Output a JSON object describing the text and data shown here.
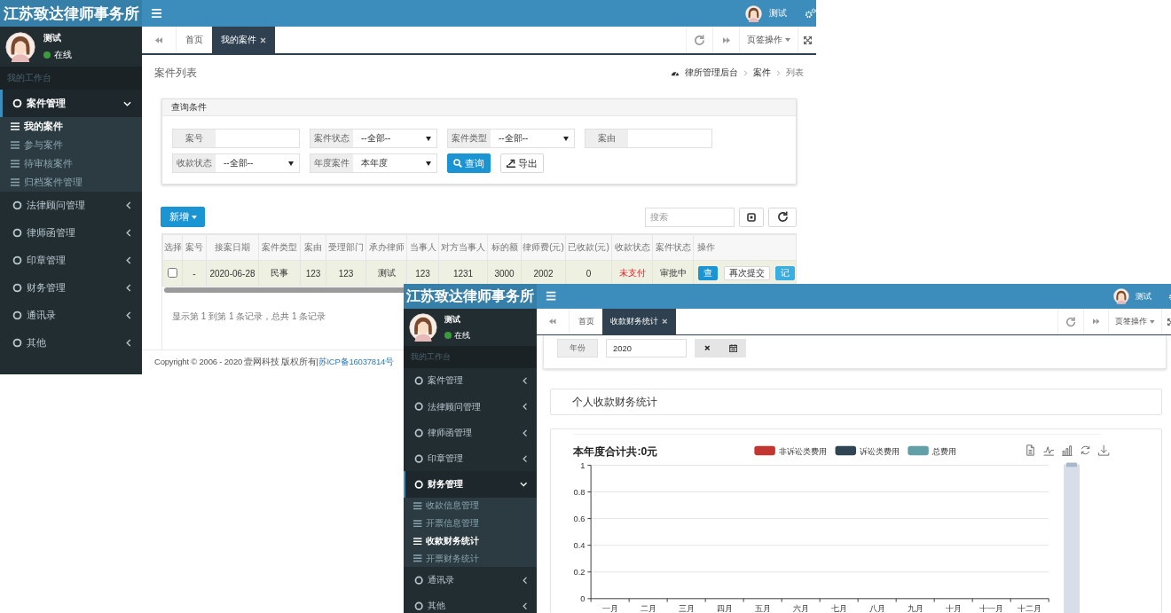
{
  "windows": [
    {
      "kind": "case-list",
      "brand": "江苏致达律师事务所",
      "user": {
        "name": "测试",
        "status": "在线"
      },
      "workbench": "我的工作台",
      "menu": [
        {
          "label": "案件管理",
          "expanded": true,
          "children": [
            {
              "label": "我的案件",
              "selected": true
            },
            {
              "label": "参与案件",
              "selected": false
            },
            {
              "label": "待审核案件",
              "selected": false
            },
            {
              "label": "归档案件管理",
              "selected": false
            }
          ]
        },
        {
          "label": "法律顾问管理",
          "expanded": false
        },
        {
          "label": "律师函管理",
          "expanded": false
        },
        {
          "label": "印章管理",
          "expanded": false
        },
        {
          "label": "财务管理",
          "expanded": false
        },
        {
          "label": "通讯录",
          "expanded": false
        },
        {
          "label": "其他",
          "expanded": false
        }
      ],
      "header_user": "测试",
      "tabs": [
        {
          "label": "首页",
          "selected": false
        },
        {
          "label": "我的案件",
          "selected": true
        }
      ],
      "tab_menu": "页签操作",
      "page": {
        "title": "案件列表",
        "breadcrumb": [
          "律所管理后台",
          "案件",
          "列表"
        ],
        "filter": {
          "title": "查询条件",
          "rows": [
            [
              {
                "label": "案号",
                "kind": "text"
              },
              {
                "label": "案件状态",
                "kind": "select",
                "value": "--全部--"
              },
              {
                "label": "案件类型",
                "kind": "select",
                "value": "--全部--"
              },
              {
                "label": "案由",
                "kind": "text"
              }
            ],
            [
              {
                "label": "收款状态",
                "kind": "select",
                "value": "--全部--"
              },
              {
                "label": "年度案件",
                "kind": "select",
                "value": "本年度"
              }
            ]
          ],
          "buttons": [
            {
              "label": "查询",
              "kind": "primary"
            },
            {
              "label": "导出",
              "kind": "default"
            }
          ]
        },
        "add_button": "新增",
        "search_placeholder": "搜索",
        "table": {
          "columns": [
            "选择",
            "案号",
            "接案日期",
            "案件类型",
            "案由",
            "受理部门",
            "承办律师",
            "当事人",
            "对方当事人",
            "标的额",
            "律师费(元)",
            "已收款(元)",
            "收款状态",
            "案件状态",
            "操作"
          ],
          "rows": [
            {
              "cells": [
                {
                  "kind": "checkbox",
                  "checked": false
                },
                {
                  "kind": "text",
                  "text": "-"
                },
                {
                  "kind": "text",
                  "text": "2020-06-28"
                },
                {
                  "kind": "text",
                  "text": "民事"
                },
                {
                  "kind": "text",
                  "text": "123"
                },
                {
                  "kind": "text",
                  "text": "123"
                },
                {
                  "kind": "text",
                  "text": "测试"
                },
                {
                  "kind": "text",
                  "text": "123"
                },
                {
                  "kind": "text",
                  "text": "1231"
                },
                {
                  "kind": "text",
                  "text": "3000"
                },
                {
                  "kind": "text",
                  "text": "2002"
                },
                {
                  "kind": "text",
                  "text": "0"
                },
                {
                  "kind": "text",
                  "text": "未支付",
                  "alert": true
                },
                {
                  "kind": "text",
                  "text": "审批中"
                },
                {
                  "kind": "actions",
                  "buttons": [
                    {
                      "label": "查",
                      "kind": "primary"
                    },
                    {
                      "label": "再次提交",
                      "kind": "default"
                    },
                    {
                      "label": "记",
                      "kind": "info"
                    }
                  ]
                }
              ]
            }
          ]
        },
        "pagination": "显示第 1 到第 1 条记录，总共 1 条记录"
      },
      "footer": {
        "text": "Copyright © 2006 - 2020 壹网科技 版权所有|",
        "link": "苏ICP备16037814号"
      }
    },
    {
      "kind": "finance-stats",
      "brand": "江苏致达律师事务所",
      "user": {
        "name": "测试",
        "status": "在线"
      },
      "workbench": "我的工作台",
      "menu": [
        {
          "label": "案件管理",
          "expanded": false
        },
        {
          "label": "法律顾问管理",
          "expanded": false
        },
        {
          "label": "律师函管理",
          "expanded": false
        },
        {
          "label": "印章管理",
          "expanded": false
        },
        {
          "label": "财务管理",
          "expanded": true,
          "children": [
            {
              "label": "收款信息管理",
              "selected": false
            },
            {
              "label": "开票信息管理",
              "selected": false
            },
            {
              "label": "收款财务统计",
              "selected": true
            },
            {
              "label": "开票财务统计",
              "selected": false
            }
          ]
        },
        {
          "label": "通讯录",
          "expanded": false
        },
        {
          "label": "其他",
          "expanded": false
        }
      ],
      "header_user": "测试",
      "tabs": [
        {
          "label": "首页",
          "selected": false
        },
        {
          "label": "收款财务统计",
          "selected": true
        }
      ],
      "tab_menu": "页签操作",
      "page": {
        "filter": {
          "label": "年份",
          "value": "2020"
        },
        "panel_title": "个人收款财务统计",
        "chart_data": {
          "type": "bar",
          "title": "本年度合计共:0元",
          "categories": [
            "一月",
            "二月",
            "三月",
            "四月",
            "五月",
            "六月",
            "七月",
            "八月",
            "九月",
            "十月",
            "十一月",
            "十二月"
          ],
          "series": [
            {
              "name": "非诉讼类费用",
              "color": "#c23531",
              "values": [
                0,
                0,
                0,
                0,
                0,
                0,
                0,
                0,
                0,
                0,
                0,
                0
              ]
            },
            {
              "name": "诉讼类费用",
              "color": "#2f4554",
              "values": [
                0,
                0,
                0,
                0,
                0,
                0,
                0,
                0,
                0,
                0,
                0,
                0
              ]
            },
            {
              "name": "总费用",
              "color": "#61a0a8",
              "values": [
                0,
                0,
                0,
                0,
                0,
                0,
                0,
                0,
                0,
                0,
                0,
                0
              ]
            }
          ],
          "ylim": [
            0,
            1
          ],
          "yticks": [
            0,
            0.2,
            0.4,
            0.6,
            0.8,
            1
          ],
          "grid": true
        }
      }
    }
  ]
}
